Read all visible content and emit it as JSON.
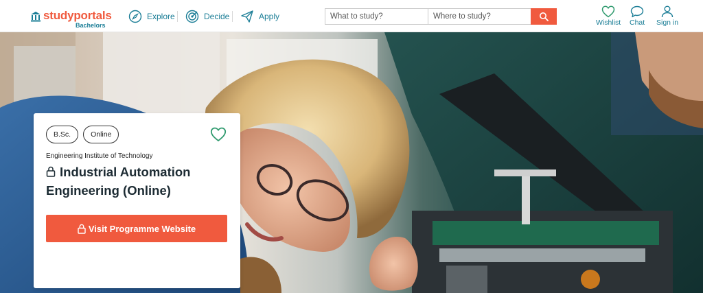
{
  "header": {
    "logo_text": "studyportals",
    "logo_sub": "Bachelors",
    "nav": [
      {
        "label": "Explore",
        "icon": "compass-icon"
      },
      {
        "label": "Decide",
        "icon": "target-icon"
      },
      {
        "label": "Apply",
        "icon": "paper-plane-icon"
      }
    ],
    "search": {
      "what_placeholder": "What to study?",
      "where_placeholder": "Where to study?",
      "button_icon": "search-icon"
    },
    "right_nav": [
      {
        "label": "Wishlist",
        "icon": "heart-icon"
      },
      {
        "label": "Chat",
        "icon": "chat-bubble-icon"
      },
      {
        "label": "Sign in",
        "icon": "user-icon"
      }
    ]
  },
  "card": {
    "badges": [
      "B.Sc.",
      "Online"
    ],
    "university": "Engineering Institute of Technology",
    "title": "Industrial Automation Engineering (Online)",
    "visit_label": "Visit Programme Website"
  },
  "colors": {
    "brand_orange": "#f05a3e",
    "brand_teal": "#1a7d96",
    "heart_green": "#2f9a6e",
    "title_dark": "#1c2b33"
  }
}
